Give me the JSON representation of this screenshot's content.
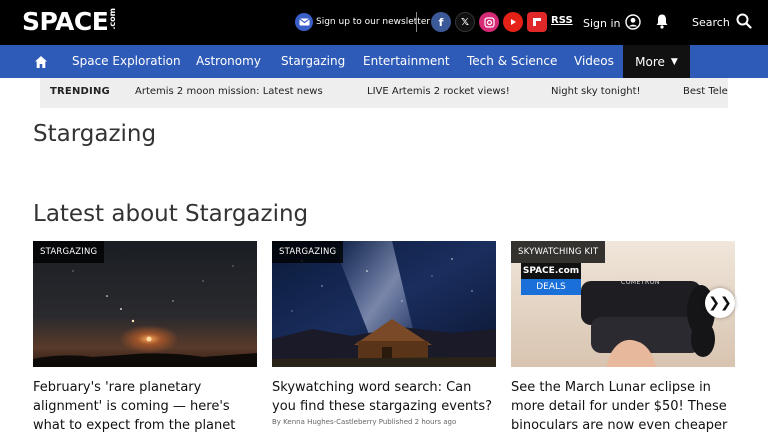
{
  "header": {
    "logo_main": "SPACE",
    "logo_suffix": ".com",
    "newsletter_label": "Sign up to our newsletter",
    "rss_label": "RSS",
    "signin_label": "Sign in",
    "search_label": "Search",
    "social_icons": [
      "facebook-icon",
      "x-icon",
      "instagram-icon",
      "youtube-icon",
      "flipboard-icon"
    ]
  },
  "nav": {
    "items": [
      "Space Exploration",
      "Astronomy",
      "Stargazing",
      "Entertainment",
      "Tech & Science",
      "Videos"
    ],
    "more_label": "More"
  },
  "trending": {
    "label": "TRENDING",
    "items": [
      "Artemis 2 moon mission: Latest news",
      "LIVE Artemis 2 rocket views!",
      "Night sky tonight!",
      "Best Tele"
    ]
  },
  "page": {
    "title": "Stargazing",
    "section_title": "Latest about Stargazing"
  },
  "cards": [
    {
      "tag": "STARGAZING",
      "title": "February's 'rare planetary alignment' is coming — here's what to expect from the planet"
    },
    {
      "tag": "STARGAZING",
      "title": "Skywatching word search: Can you find these stargazing events?",
      "byline": "By Kenna Hughes-Castleberry Published 2 hours ago"
    },
    {
      "tag": "SKYWATCHING KIT",
      "title": "See the March Lunar eclipse in more detail for under $50! These binoculars are now even cheaper",
      "badge_top": "SPACE.com",
      "badge_bottom": "DEALS",
      "product_brand": "COMETRON"
    }
  ],
  "colors": {
    "nav_blue": "#2e5ab8",
    "top_black": "#000000",
    "trending_bg": "#eeeeee"
  }
}
